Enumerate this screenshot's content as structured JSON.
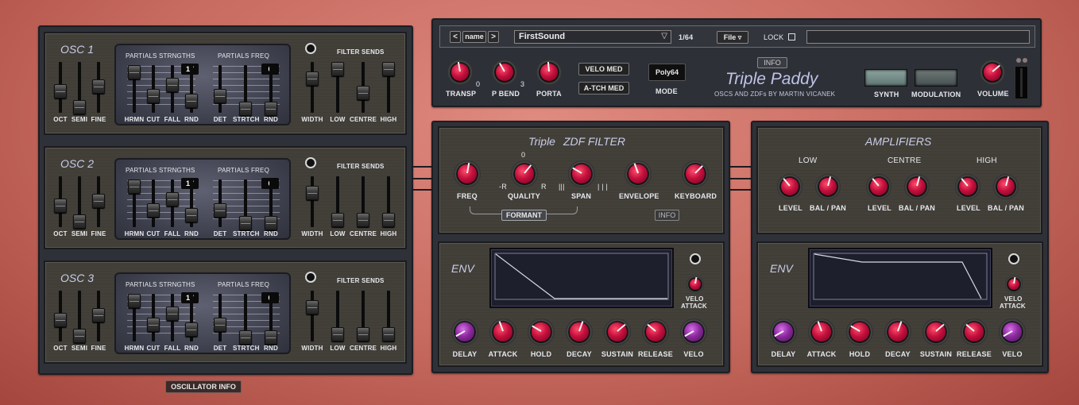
{
  "osc": [
    {
      "title": "OSC 1",
      "filter_num": "17",
      "freq_num": "6"
    },
    {
      "title": "OSC 2",
      "filter_num": "17",
      "freq_num": "6"
    },
    {
      "title": "OSC 3",
      "filter_num": "17",
      "freq_num": "6"
    }
  ],
  "osc_labels": {
    "partials_strengths": "PARTIALS STRNGTHS",
    "partials_freq": "PARTIALS FREQ",
    "filter_sends": "FILTER  SENDS",
    "oct": "OCT",
    "semi": "SEMI",
    "fine": "FINE",
    "hrmn": "HRMN",
    "cut": "CUT",
    "fall": "FALL",
    "rnd": "RND",
    "det": "DET",
    "strtch": "STRTCH",
    "width": "WIDTH",
    "low": "LOW",
    "centre": "CENTRE",
    "high": "HIGH"
  },
  "oscillator_info": "OSCILLATOR INFO",
  "header": {
    "prev": "<",
    "name": "name",
    "next": ">",
    "preset": "FirstSound",
    "dropdown": "▽",
    "count": "1/64",
    "file": "File ▿",
    "lock": "LOCK",
    "search": ""
  },
  "controls": {
    "transp": "TRANSP",
    "transp_val": "0",
    "pbend": "P BEND",
    "pbend_val": "3",
    "porta": "PORTA",
    "velo_med": "VELO MED",
    "atch_med": "A-TCH MED",
    "mode_val": "Poly64",
    "mode": "MODE",
    "info": "INFO",
    "synth_title": "Triple Paddy",
    "credit": "OSCS AND ZDFs BY MARTIN VICANEK",
    "synth": "SYNTH",
    "modulation": "MODULATION",
    "volume": "VOLUME"
  },
  "filter": {
    "title_a": "Triple",
    "title_b": "ZDF FILTER",
    "freq": "FREQ",
    "quality": "QUALITY",
    "q_top": "0",
    "q_left": "-R",
    "q_right": "R",
    "span": "SPAN",
    "span_left": "|||",
    "span_right": "| | |",
    "envelope": "ENVELOPE",
    "keyboard": "KEYBOARD",
    "formant": "FORMANT",
    "info": "INFO"
  },
  "amps": {
    "title": "AMPLIFIERS",
    "low": "LOW",
    "centre": "CENTRE",
    "high": "HIGH",
    "level": "LEVEL",
    "balpan": "BAL / PAN"
  },
  "env": {
    "title": "ENV",
    "delay": "DELAY",
    "attack": "ATTACK",
    "hold": "HOLD",
    "decay": "DECAY",
    "sustain": "SUSTAIN",
    "release": "RELEASE",
    "velo": "VELO",
    "velo_attack_1": "VELO",
    "velo_attack_2": "ATTACK"
  }
}
